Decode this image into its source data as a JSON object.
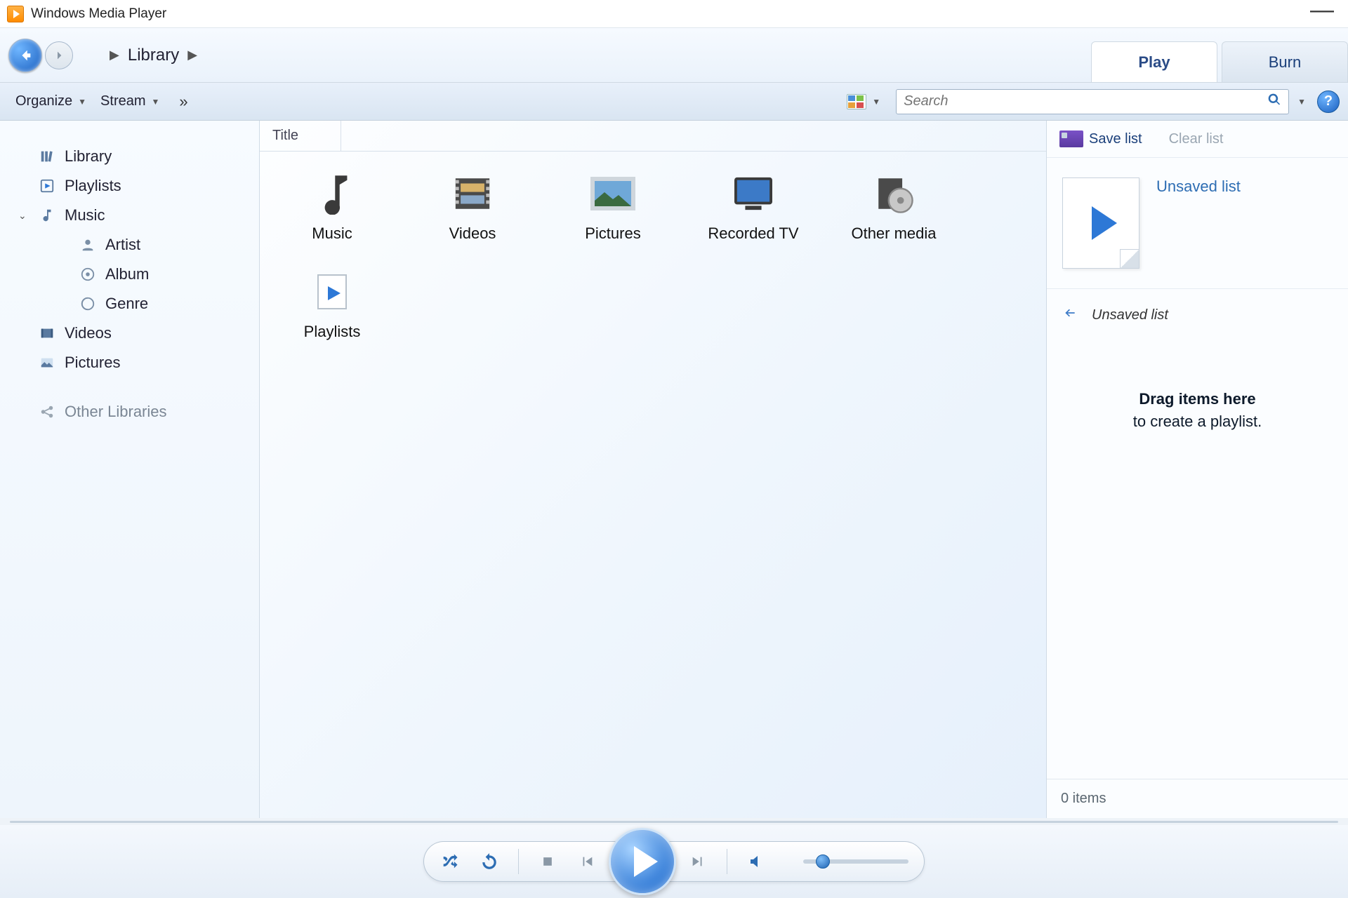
{
  "app": {
    "title": "Windows Media Player"
  },
  "breadcrumb": {
    "root": "Library"
  },
  "tabs": {
    "play": "Play",
    "burn": "Burn"
  },
  "toolbar": {
    "organize": "Organize",
    "stream": "Stream",
    "search_placeholder": "Search"
  },
  "sidebar": {
    "library": "Library",
    "playlists": "Playlists",
    "music": "Music",
    "artist": "Artist",
    "album": "Album",
    "genre": "Genre",
    "videos": "Videos",
    "pictures": "Pictures",
    "other_libraries": "Other Libraries"
  },
  "columns": {
    "title": "Title"
  },
  "tiles": {
    "music": "Music",
    "videos": "Videos",
    "pictures": "Pictures",
    "recorded_tv": "Recorded TV",
    "other_media": "Other media",
    "playlists": "Playlists"
  },
  "right": {
    "save_list": "Save list",
    "clear_list": "Clear list",
    "unsaved_list_title": "Unsaved list",
    "current_list": "Unsaved list",
    "drop_l1": "Drag items here",
    "drop_l2": "to create a playlist.",
    "footer": "0 items"
  }
}
